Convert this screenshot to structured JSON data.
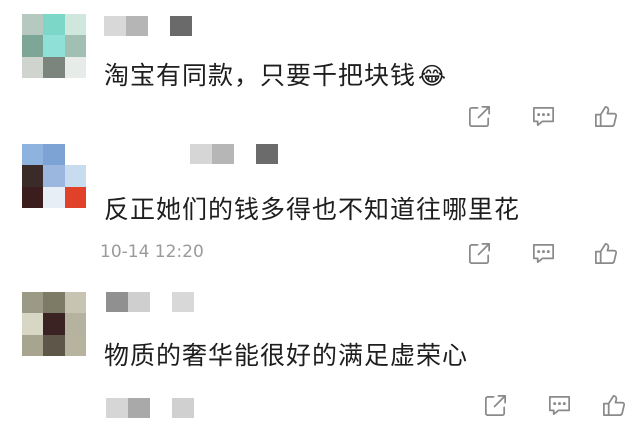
{
  "comments": [
    {
      "text": "淘宝有同款，只要千把块钱",
      "emoji": "😂",
      "time": "",
      "avatar_colors": [
        "#b6c9c0",
        "#7dd7c9",
        "#cfe7dd",
        "#7ea696",
        "#8fe0d6",
        "#a2bfb4",
        "#cfd4cf",
        "#7b857d",
        "#e7ece9"
      ],
      "name_colors": [
        "#d8d8d8",
        "#b5b5b5",
        "#ffffff",
        "#6a6a6a"
      ]
    },
    {
      "text": "反正她们的钱多得也不知道往哪里花",
      "emoji": "",
      "time": "10-14 12:20",
      "avatar_colors": [
        "#8eb3df",
        "#7ca3d4",
        "#ffffff",
        "#3a2a28",
        "#9bb7df",
        "#c8dcef",
        "#3c1d1d",
        "#e7eef6",
        "#e04128"
      ],
      "name_colors": [
        "#d6d6d6",
        "#b6b6b6",
        "#ffffff",
        "#6b6b6b"
      ]
    },
    {
      "text": "物质的奢华能很好的满足虚荣心",
      "emoji": "",
      "time": "",
      "avatar_colors": [
        "#9a9a86",
        "#7d7a66",
        "#c7c4b3",
        "#d8d7c6",
        "#3b2323",
        "#b5b29f",
        "#a7a58f",
        "#5e5749",
        "#b6b39e"
      ],
      "name_colors": [
        "#909090",
        "#cfcfcf",
        "#ffffff",
        "#d8d8d8"
      ]
    },
    {
      "name_colors": [
        "#d6d6d6",
        "#a9a9a9",
        "#ffffff",
        "#d0d0d0"
      ]
    }
  ],
  "action_icons": [
    "share-icon",
    "reply-icon",
    "like-icon"
  ]
}
